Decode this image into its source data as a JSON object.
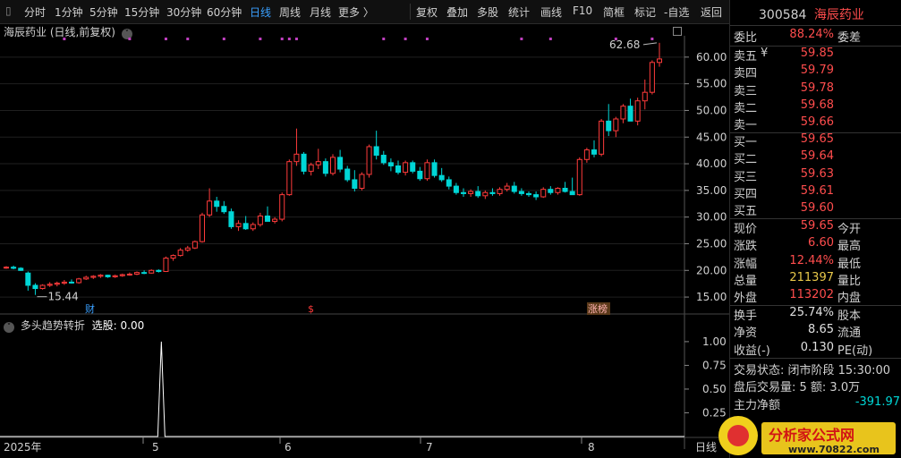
{
  "toolbar": {
    "periods": [
      "分时",
      "1分钟",
      "5分钟",
      "15分钟",
      "30分钟",
      "60分钟",
      "日线",
      "周线",
      "月线",
      "更多 〉"
    ],
    "active_period": "日线",
    "actions": [
      "复权",
      "叠加",
      "多股",
      "统计",
      "画线",
      "F10",
      "简框",
      "标记",
      "-自选",
      "返回"
    ]
  },
  "chart": {
    "title": "海辰药业 (日线,前复权)",
    "price_axis": [
      "60.00",
      "55.00",
      "50.00",
      "45.00",
      "40.00",
      "35.00",
      "30.00",
      "25.00",
      "20.00",
      "15.00"
    ],
    "high_label": "62.68",
    "low_label": "15.44",
    "events": [
      "财",
      "$",
      "涨榜"
    ],
    "date_axis": [
      "2025年",
      "5",
      "6",
      "7",
      "8",
      "日线"
    ],
    "colors": {
      "up": "#ff3b3b",
      "down": "#00d6d6",
      "accent": "#3aa0ff",
      "marker": "#c040c0"
    }
  },
  "indicator": {
    "name": "多头趋势转折",
    "label": "选股: 0.00",
    "axis": [
      "1.00",
      "0.75",
      "0.50",
      "0.25"
    ]
  },
  "chart_data": {
    "type": "candlestick",
    "price_ylim": [
      13,
      64
    ],
    "candles": [
      [
        20.5,
        20.8,
        20.3,
        20.6
      ],
      [
        20.6,
        20.9,
        20.2,
        20.4
      ],
      [
        20.4,
        20.6,
        19.9,
        20.0
      ],
      [
        19.5,
        19.8,
        16.2,
        17.2
      ],
      [
        17.2,
        17.6,
        15.4,
        16.6
      ],
      [
        16.6,
        17.4,
        16.4,
        17.2
      ],
      [
        17.2,
        17.8,
        16.9,
        17.4
      ],
      [
        17.4,
        17.9,
        17.0,
        17.6
      ],
      [
        17.6,
        18.2,
        17.3,
        17.8
      ],
      [
        17.8,
        18.3,
        17.5,
        17.7
      ],
      [
        17.7,
        18.6,
        17.5,
        18.4
      ],
      [
        18.4,
        19.0,
        18.2,
        18.7
      ],
      [
        18.7,
        19.1,
        18.4,
        18.9
      ],
      [
        18.9,
        19.3,
        18.6,
        19.1
      ],
      [
        19.1,
        19.2,
        18.6,
        18.8
      ],
      [
        18.8,
        19.2,
        18.6,
        19.0
      ],
      [
        19.0,
        19.4,
        18.8,
        19.2
      ],
      [
        19.2,
        19.6,
        19.0,
        19.3
      ],
      [
        19.3,
        19.8,
        19.1,
        19.6
      ],
      [
        19.6,
        20.0,
        19.3,
        19.5
      ],
      [
        19.5,
        20.2,
        19.4,
        20.0
      ],
      [
        20.0,
        20.2,
        19.6,
        19.8
      ],
      [
        19.8,
        22.6,
        19.7,
        22.3
      ],
      [
        22.3,
        23.0,
        21.8,
        22.8
      ],
      [
        22.8,
        24.2,
        22.6,
        23.8
      ],
      [
        23.8,
        24.6,
        23.5,
        24.2
      ],
      [
        24.2,
        25.6,
        24.0,
        25.4
      ],
      [
        25.4,
        30.8,
        25.2,
        30.4
      ],
      [
        30.4,
        35.4,
        30.0,
        33.0
      ],
      [
        33.0,
        33.8,
        31.0,
        32.0
      ],
      [
        32.0,
        33.0,
        30.6,
        31.0
      ],
      [
        31.0,
        31.6,
        27.8,
        28.2
      ],
      [
        28.2,
        29.4,
        27.4,
        28.8
      ],
      [
        28.8,
        30.2,
        27.6,
        27.8
      ],
      [
        27.8,
        29.0,
        27.4,
        28.6
      ],
      [
        28.6,
        30.8,
        28.2,
        30.2
      ],
      [
        30.2,
        32.0,
        29.8,
        29.2
      ],
      [
        29.2,
        30.0,
        28.8,
        29.6
      ],
      [
        29.6,
        34.6,
        29.2,
        34.2
      ],
      [
        34.2,
        40.8,
        34.0,
        40.4
      ],
      [
        40.4,
        46.6,
        39.6,
        41.8
      ],
      [
        41.8,
        42.2,
        38.0,
        38.6
      ],
      [
        38.6,
        40.2,
        37.8,
        39.8
      ],
      [
        39.8,
        42.8,
        39.0,
        40.4
      ],
      [
        40.4,
        41.0,
        37.6,
        38.2
      ],
      [
        38.2,
        41.8,
        37.8,
        41.2
      ],
      [
        41.2,
        42.6,
        38.4,
        39.0
      ],
      [
        39.0,
        39.6,
        36.6,
        37.0
      ],
      [
        37.0,
        38.8,
        34.8,
        35.4
      ],
      [
        35.4,
        38.4,
        35.0,
        38.0
      ],
      [
        38.0,
        43.6,
        37.4,
        43.2
      ],
      [
        43.2,
        46.2,
        40.8,
        41.6
      ],
      [
        41.6,
        42.4,
        39.8,
        40.2
      ],
      [
        40.2,
        41.0,
        38.6,
        39.6
      ],
      [
        39.6,
        40.6,
        38.0,
        38.4
      ],
      [
        38.4,
        40.6,
        37.8,
        40.2
      ],
      [
        40.2,
        40.6,
        38.2,
        38.6
      ],
      [
        38.6,
        39.4,
        36.8,
        37.2
      ],
      [
        37.2,
        40.8,
        36.8,
        40.2
      ],
      [
        40.2,
        40.8,
        37.4,
        37.8
      ],
      [
        37.8,
        39.2,
        36.6,
        37.0
      ],
      [
        37.0,
        37.6,
        35.2,
        35.8
      ],
      [
        35.8,
        36.4,
        34.2,
        34.6
      ],
      [
        34.6,
        35.4,
        33.8,
        34.4
      ],
      [
        34.4,
        35.2,
        33.8,
        34.8
      ],
      [
        34.8,
        35.8,
        33.6,
        34.0
      ],
      [
        34.0,
        35.0,
        33.4,
        34.6
      ],
      [
        34.6,
        35.4,
        34.0,
        34.4
      ],
      [
        34.4,
        35.6,
        34.0,
        35.2
      ],
      [
        35.2,
        36.4,
        34.8,
        35.8
      ],
      [
        35.8,
        36.6,
        34.4,
        34.8
      ],
      [
        34.8,
        35.4,
        34.0,
        34.4
      ],
      [
        34.4,
        34.8,
        33.8,
        34.2
      ],
      [
        34.2,
        34.8,
        33.2,
        33.8
      ],
      [
        33.8,
        35.6,
        33.6,
        35.2
      ],
      [
        35.2,
        35.8,
        34.2,
        34.6
      ],
      [
        34.6,
        35.6,
        34.2,
        35.4
      ],
      [
        35.4,
        36.6,
        34.6,
        34.8
      ],
      [
        34.8,
        37.4,
        34.4,
        34.2
      ],
      [
        34.2,
        41.2,
        34.0,
        40.8
      ],
      [
        40.8,
        43.0,
        40.2,
        42.6
      ],
      [
        42.6,
        44.4,
        41.2,
        41.8
      ],
      [
        41.8,
        48.4,
        41.4,
        48.0
      ],
      [
        48.0,
        51.2,
        45.2,
        46.2
      ],
      [
        46.2,
        48.8,
        45.0,
        48.4
      ],
      [
        48.4,
        51.2,
        47.6,
        50.8
      ],
      [
        50.8,
        52.2,
        48.4,
        48.0
      ],
      [
        48.0,
        52.4,
        47.2,
        51.8
      ],
      [
        51.8,
        55.8,
        50.2,
        53.4
      ],
      [
        53.4,
        59.4,
        53.0,
        59.0
      ],
      [
        59.0,
        62.68,
        58.2,
        59.65
      ]
    ],
    "indicator_signal_index": 21,
    "indicator_ylim": [
      0,
      1.15
    ]
  },
  "panel": {
    "code": "300584",
    "name": "海辰药业",
    "weibi": {
      "label": "委比",
      "value": "88.24%",
      "label2": "委差"
    },
    "sell": [
      {
        "label": "卖五",
        "mark": "¥",
        "price": "59.85"
      },
      {
        "label": "卖四",
        "mark": "",
        "price": "59.79"
      },
      {
        "label": "卖三",
        "mark": "",
        "price": "59.78"
      },
      {
        "label": "卖二",
        "mark": "",
        "price": "59.68"
      },
      {
        "label": "卖一",
        "mark": "",
        "price": "59.66"
      }
    ],
    "buy": [
      {
        "label": "买一",
        "price": "59.65"
      },
      {
        "label": "买二",
        "price": "59.64"
      },
      {
        "label": "买三",
        "price": "59.63"
      },
      {
        "label": "买四",
        "price": "59.61"
      },
      {
        "label": "买五",
        "price": "59.60"
      }
    ],
    "quote": [
      {
        "label": "现价",
        "value": "59.65",
        "cls": "red",
        "label2": "今开"
      },
      {
        "label": "涨跌",
        "value": "6.60",
        "cls": "red",
        "label2": "最高"
      },
      {
        "label": "涨幅",
        "value": "12.44%",
        "cls": "red",
        "label2": "最低"
      },
      {
        "label": "总量",
        "value": "211397",
        "cls": "yellow",
        "label2": "量比"
      },
      {
        "label": "外盘",
        "value": "113202",
        "cls": "red",
        "label2": "内盘"
      }
    ],
    "stats": [
      {
        "label": "换手",
        "value": "25.74%",
        "label2": "股本"
      },
      {
        "label": "净资",
        "value": "8.65",
        "label2": "流通"
      },
      {
        "label": "收益(-)",
        "value": "0.130",
        "label2": "PE(动)"
      }
    ],
    "status_line": "交易状态: 闭市阶段 15:30:00",
    "after_line": "盘后交易量: 5  额: 3.0万",
    "main_flow": {
      "label": "主力净额",
      "value": "-391.97"
    }
  },
  "watermark": {
    "text": "分析家公式网",
    "url": "www.70822.com"
  }
}
